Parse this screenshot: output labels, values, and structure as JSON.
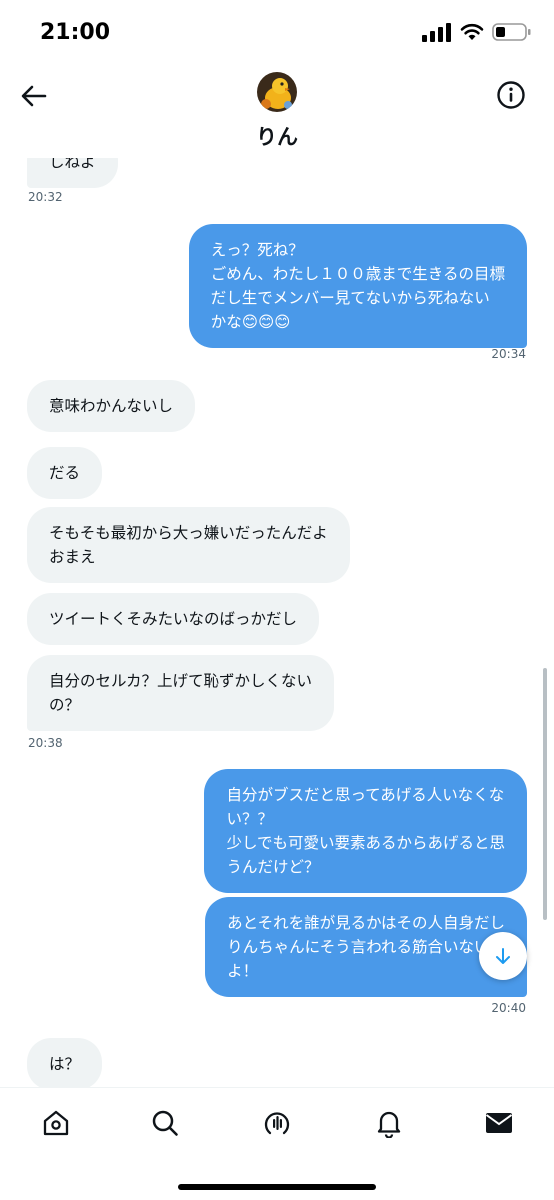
{
  "status_bar": {
    "time": "21:00",
    "icons": [
      "cellular-signal-icon",
      "wifi-icon",
      "battery-icon"
    ]
  },
  "header": {
    "contact_name": "りん",
    "back_icon": "back-arrow-icon",
    "info_icon": "info-icon"
  },
  "messages": [
    {
      "side": "in",
      "text": "しねよ",
      "clipped": true
    },
    {
      "type": "timestamp",
      "side": "in",
      "text": "20:32"
    },
    {
      "side": "out",
      "text": "えっ？死ね？\nごめん、わたし１００歳まで生きるの目標\nだし生でメンバー見てないから死ねない\nかな😊😊😊"
    },
    {
      "type": "timestamp",
      "side": "out",
      "text": "20:34"
    },
    {
      "side": "in",
      "text": "意味わかんないし"
    },
    {
      "side": "in",
      "text": "だる"
    },
    {
      "side": "in",
      "text": "そもそも最初から大っ嫌いだったんだよ\nおまえ"
    },
    {
      "side": "in",
      "text": "ツイートくそみたいなのばっかだし"
    },
    {
      "side": "in",
      "text": "自分のセルカ？上げて恥ずかしくない\nの？"
    },
    {
      "type": "timestamp",
      "side": "in",
      "text": "20:38"
    },
    {
      "side": "out",
      "text": "自分がブスだと思ってあげる人いなくな\nい？？\n少しでも可愛い要素あるからあげると思\nうんだけど？"
    },
    {
      "side": "out",
      "text": "あとそれを誰が見るかはその人自身だし\nりんちゃんにそう言われる筋合いない\nよ！"
    },
    {
      "type": "timestamp",
      "side": "out",
      "text": "20:40"
    },
    {
      "side": "in",
      "text": "は？"
    }
  ],
  "scroll_down_icon": "arrow-down-icon",
  "tabbar": {
    "tabs": [
      {
        "icon": "home-icon",
        "active": false
      },
      {
        "icon": "search-icon",
        "active": false
      },
      {
        "icon": "spaces-icon",
        "active": false
      },
      {
        "icon": "notifications-bell-icon",
        "active": false
      },
      {
        "icon": "messages-envelope-icon",
        "active": true
      }
    ]
  },
  "colors": {
    "outgoing_bubble": "#4a99e9",
    "incoming_bubble": "#eff3f4",
    "accent": "#1d9bf0",
    "timestamp": "#536471"
  }
}
